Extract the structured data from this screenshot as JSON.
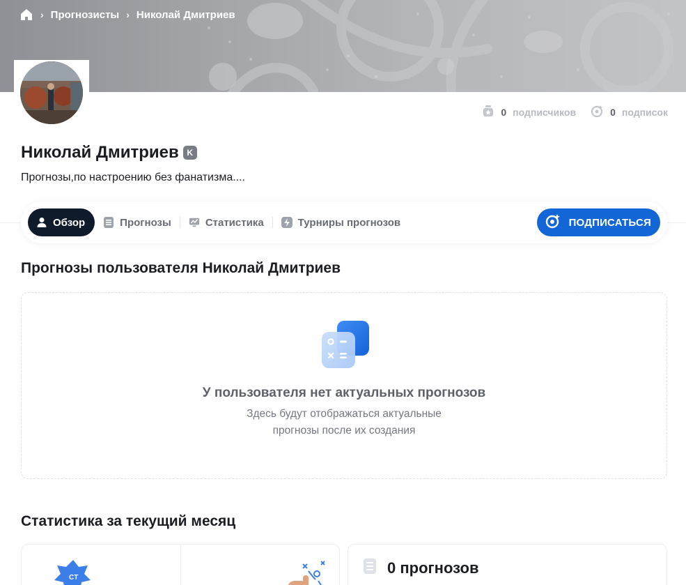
{
  "breadcrumb": {
    "items": [
      "Прогнозисты",
      "Николай Дмитриев"
    ]
  },
  "profile": {
    "name": "Николай Дмитриев",
    "badge": "K",
    "bio": "Прогнозы,по настроению без фанатизма...."
  },
  "counters": {
    "subscribers_value": "0",
    "subscribers_label": "подписчиков",
    "subscriptions_value": "0",
    "subscriptions_label": "подписок"
  },
  "tabs": [
    {
      "label": "Обзор",
      "icon": "user-icon",
      "active": true
    },
    {
      "label": "Прогнозы",
      "icon": "list-icon",
      "active": false
    },
    {
      "label": "Статистика",
      "icon": "chart-icon",
      "active": false
    },
    {
      "label": "Турниры прогнозов",
      "icon": "lightning-icon",
      "active": false
    }
  ],
  "subscribe_button": "ПОДПИСАТЬСЯ",
  "predictions_section": {
    "title": "Прогнозы пользователя Николай Дмитриев",
    "empty_title": "У пользователя нет актуальных прогнозов",
    "empty_line1": "Здесь будут отображаться актуальные",
    "empty_line2": "прогнозы после их создания"
  },
  "stats_section": {
    "title": "Статистика за текущий месяц",
    "predictions_count": "0 прогнозов"
  },
  "colors": {
    "accent": "#1366d6",
    "active_tab": "#0f1a2b"
  }
}
